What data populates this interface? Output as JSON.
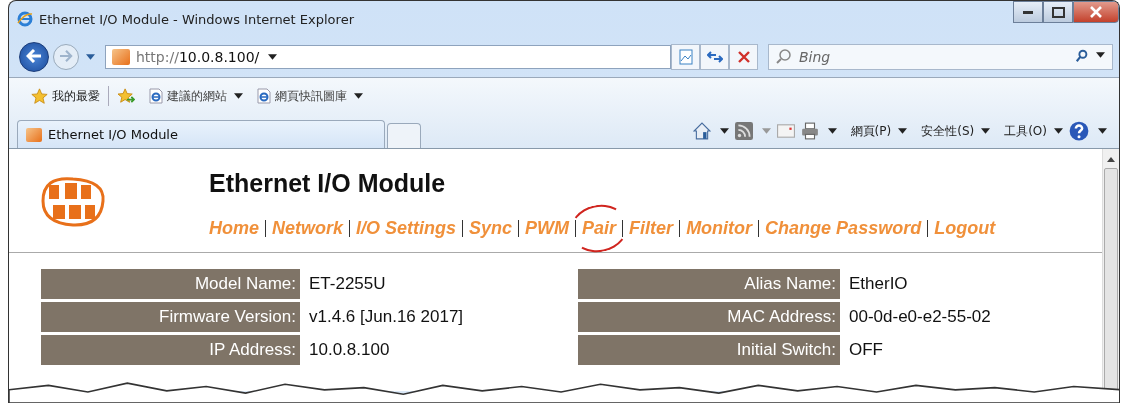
{
  "window": {
    "title": "Ethernet I/O Module - Windows Internet Explorer"
  },
  "address_bar": {
    "url_prefix": "http://",
    "url_host": "10.0.8.100/"
  },
  "search": {
    "placeholder": "Bing"
  },
  "favorites_bar": {
    "favorites": "我的最愛",
    "links": [
      "建議的網站",
      "網頁快訊圖庫"
    ]
  },
  "tabs": [
    {
      "label": "Ethernet I/O Module",
      "selected": true
    }
  ],
  "command_bar": {
    "menus": [
      "網頁(P)",
      "安全性(S)",
      "工具(O)"
    ]
  },
  "page": {
    "title": "Ethernet I/O Module",
    "nav": [
      {
        "label": "Home",
        "circled": false
      },
      {
        "label": "Network",
        "circled": false
      },
      {
        "label": "I/O Settings",
        "circled": false
      },
      {
        "label": "Sync",
        "circled": false
      },
      {
        "label": "PWM",
        "circled": false
      },
      {
        "label": "Pair",
        "circled": true
      },
      {
        "label": "Filter",
        "circled": false
      },
      {
        "label": "Monitor",
        "circled": false
      },
      {
        "label": "Change Password",
        "circled": false
      },
      {
        "label": "Logout",
        "circled": false
      }
    ],
    "info_rows": [
      {
        "left_label": "Model Name:",
        "left_value": "ET-2255U",
        "right_label": "Alias Name:",
        "right_value": "EtherIO"
      },
      {
        "left_label": "Firmware Version:",
        "left_value": "v1.4.6 [Jun.16 2017]",
        "right_label": "MAC Address:",
        "right_value": "00-0d-e0-e2-55-02"
      },
      {
        "left_label": "IP Address:",
        "left_value": "10.0.8.100",
        "right_label": "Initial Switch:",
        "right_value": "OFF"
      }
    ]
  }
}
